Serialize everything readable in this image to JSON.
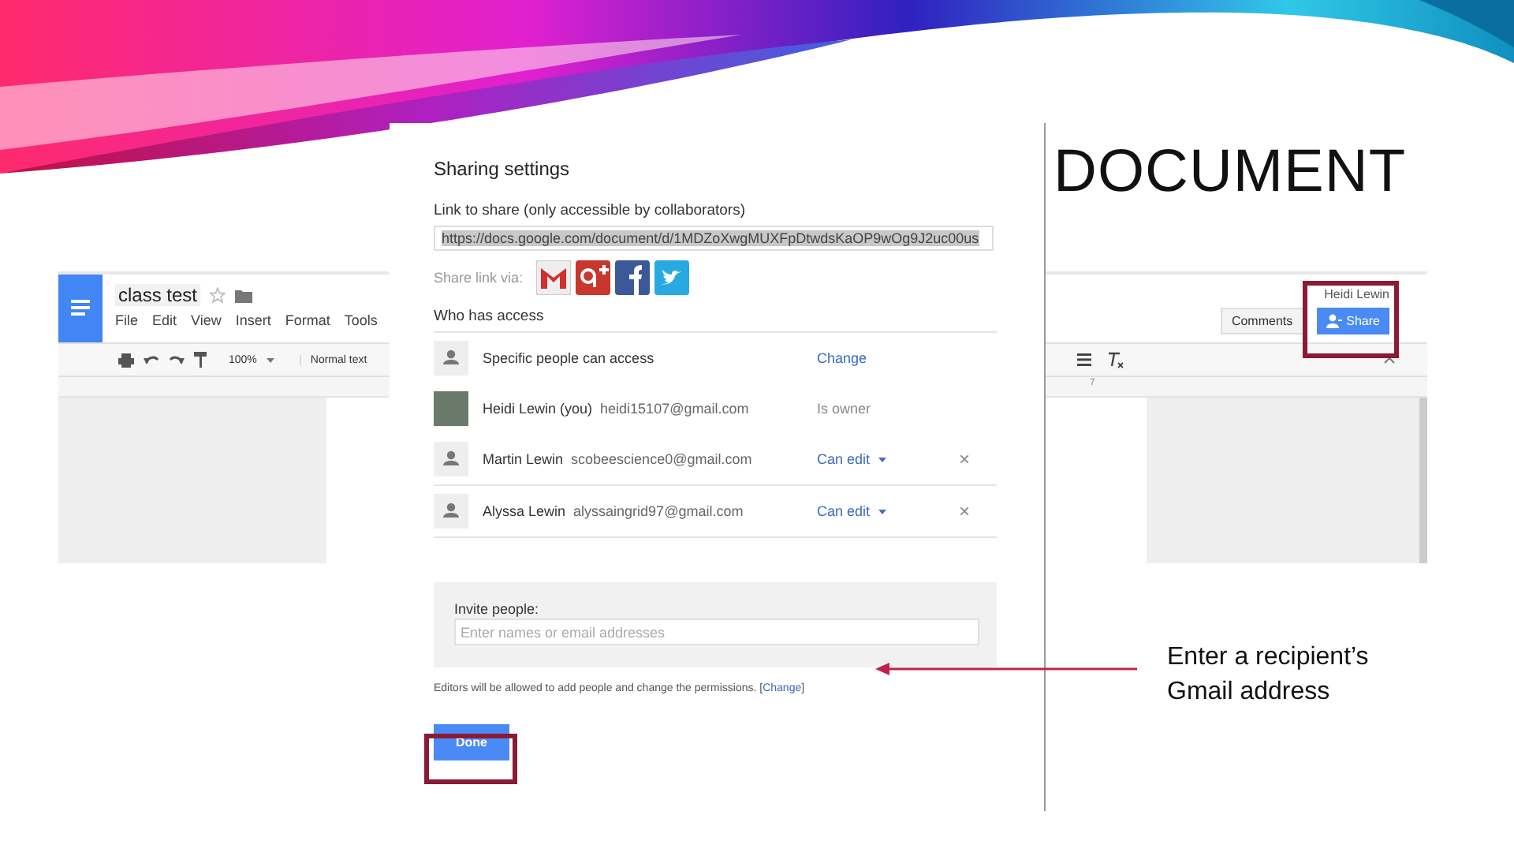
{
  "slide": {
    "title": "DOCUMENT",
    "callout": "Enter a recipient’s Gmail address"
  },
  "doc_window": {
    "doc_title": "class test",
    "menu": [
      "File",
      "Edit",
      "View",
      "Insert",
      "Format",
      "Tools"
    ],
    "zoom": "100%",
    "style": "Normal text",
    "ruler_label": "7",
    "user": "Heidi Lewin",
    "comments_button": "Comments",
    "share_button": "Share"
  },
  "dialog": {
    "title": "Sharing settings",
    "link_label": "Link to share (only accessible by collaborators)",
    "link": "https://docs.google.com/document/d/1MDZoXwgMUXFpDtwdsKaOP9wOg9J2uc00us",
    "share_via_label": "Share link via:",
    "who_label": "Who has access",
    "access": [
      {
        "kind": "visibility",
        "name": "Specific people can access",
        "role": "Change"
      },
      {
        "kind": "owner",
        "name": "Heidi Lewin (you)",
        "email": "heidi15107@gmail.com",
        "role": "Is owner"
      },
      {
        "kind": "editor",
        "name": "Martin Lewin",
        "email": "scobeescience0@gmail.com",
        "role": "Can edit",
        "remove": "×"
      },
      {
        "kind": "editor",
        "name": "Alyssa Lewin",
        "email": "alyssaingrid97@gmail.com",
        "role": "Can edit",
        "remove": "×"
      }
    ],
    "invite_label": "Invite people:",
    "invite_placeholder": "Enter names or email addresses",
    "note": "Editors will be allowed to add people and change the permissions. [",
    "note_link": "Change",
    "note_end": "]",
    "done_button": "Done"
  }
}
